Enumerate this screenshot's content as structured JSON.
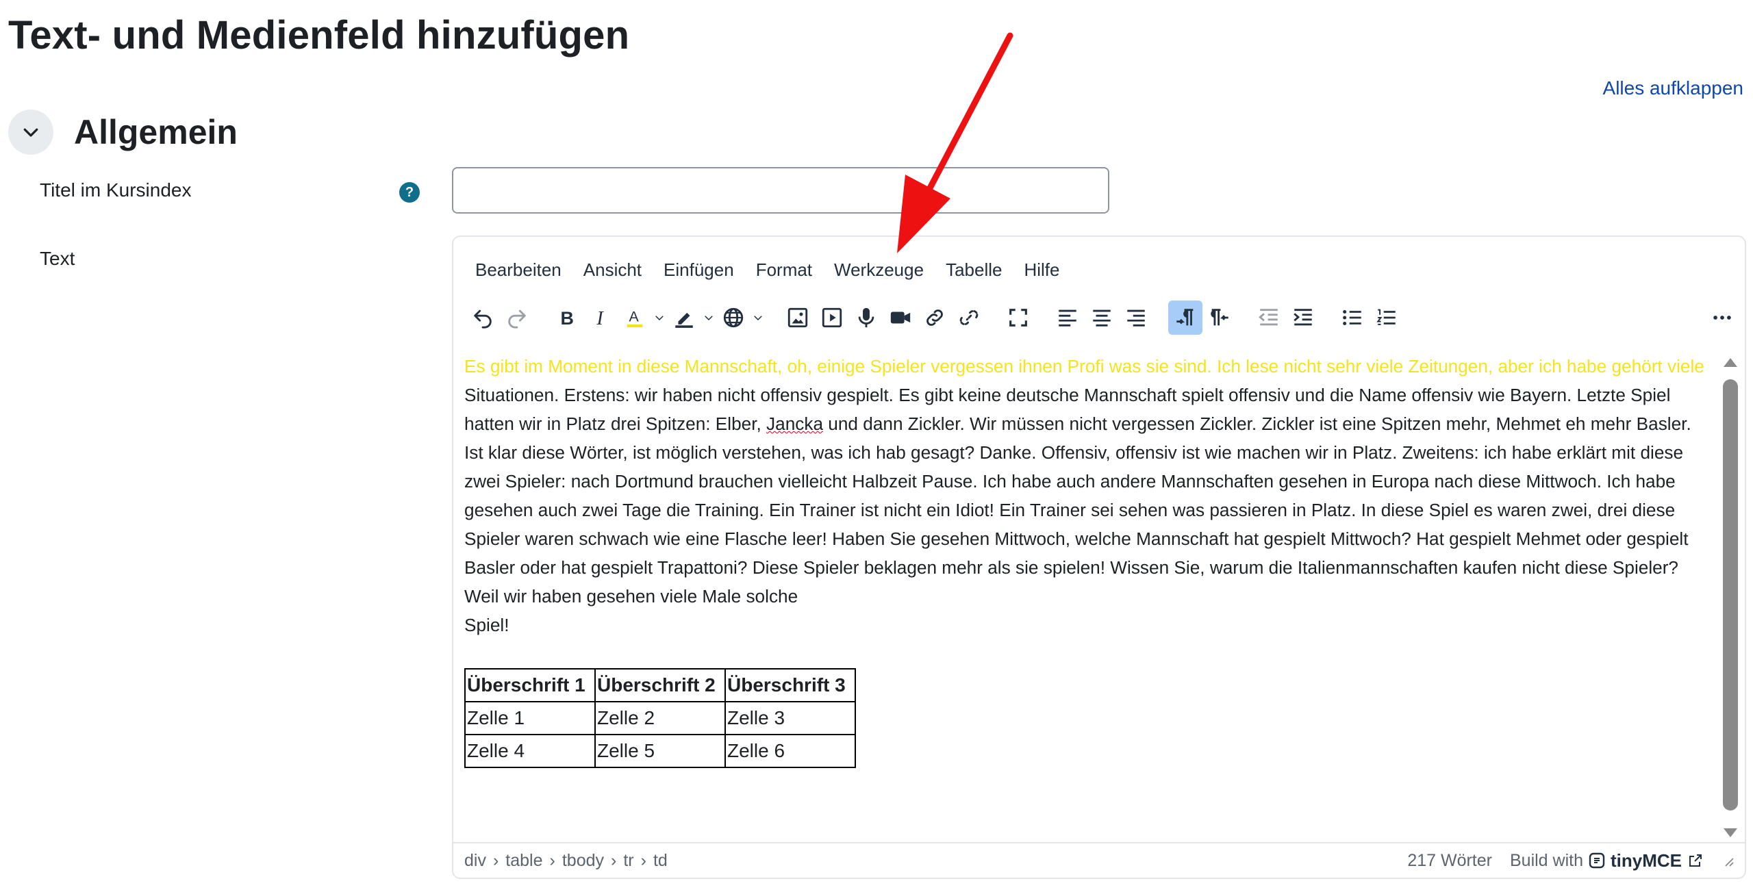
{
  "page": {
    "title": "Text- und Medienfeld hinzufügen",
    "expand_all": "Alles aufklappen"
  },
  "section": {
    "title": "Allgemein"
  },
  "fields": {
    "title_label": "Titel im Kursindex",
    "title_value": "",
    "text_label": "Text"
  },
  "editor": {
    "menu": [
      "Bearbeiten",
      "Ansicht",
      "Einfügen",
      "Format",
      "Werkzeuge",
      "Tabelle",
      "Hilfe"
    ],
    "content": {
      "yellow_text": "Es gibt im Moment in diese Mannschaft, oh, einige Spieler vergessen ihnen Profi was sie sind. Ich lese nicht sehr viele Zeitungen, aber ich habe gehört viele",
      "text_before_spell": " Situationen. Erstens: wir haben nicht offensiv gespielt. Es gibt keine deutsche Mannschaft spielt offensiv und die Name offensiv wie Bayern. Letzte Spiel hatten wir in Platz drei Spitzen: Elber, ",
      "spell_word": "Jancka",
      "text_after_spell": " und dann Zickler. Wir müssen nicht vergessen Zickler. Zickler ist eine Spitzen mehr, Mehmet eh mehr Basler. Ist klar diese Wörter, ist möglich verstehen, was ich hab gesagt? Danke. Offensiv, offensiv ist wie machen wir in Platz. Zweitens: ich habe erklärt mit diese zwei Spieler: nach Dortmund brauchen vielleicht Halbzeit Pause. Ich habe auch andere Mannschaften gesehen in Europa nach diese Mittwoch. Ich habe gesehen auch zwei Tage die Training. Ein Trainer ist nicht ein Idiot! Ein Trainer sei sehen was passieren in Platz. In diese Spiel es waren zwei, drei diese Spieler waren schwach wie eine Flasche leer! Haben Sie gesehen Mittwoch, welche Mannschaft hat gespielt Mittwoch? Hat gespielt Mehmet oder gespielt Basler oder hat gespielt Trapattoni? Diese Spieler beklagen mehr als sie spielen! Wissen Sie, warum die Italienmannschaften kaufen nicht diese Spieler? Weil wir haben gesehen viele Male solche",
      "last_line": "Spiel!",
      "table": {
        "headers": [
          "Überschrift 1",
          "Überschrift 2",
          "Überschrift 3"
        ],
        "rows": [
          [
            "Zelle 1",
            "Zelle 2",
            "Zelle 3"
          ],
          [
            "Zelle 4",
            "Zelle 5",
            "Zelle 6"
          ]
        ]
      }
    },
    "status": {
      "path": [
        "div",
        "table",
        "tbody",
        "tr",
        "td"
      ],
      "words": "217 Wörter",
      "build_with": "Build with",
      "brand": "tinyMCE"
    }
  },
  "colors": {
    "yellow_text": "#f3e51a",
    "link": "#0f47ad",
    "help_icon": "#0f6e8a",
    "active_button": "#a6ccf7",
    "arrow": "#ee1111"
  }
}
